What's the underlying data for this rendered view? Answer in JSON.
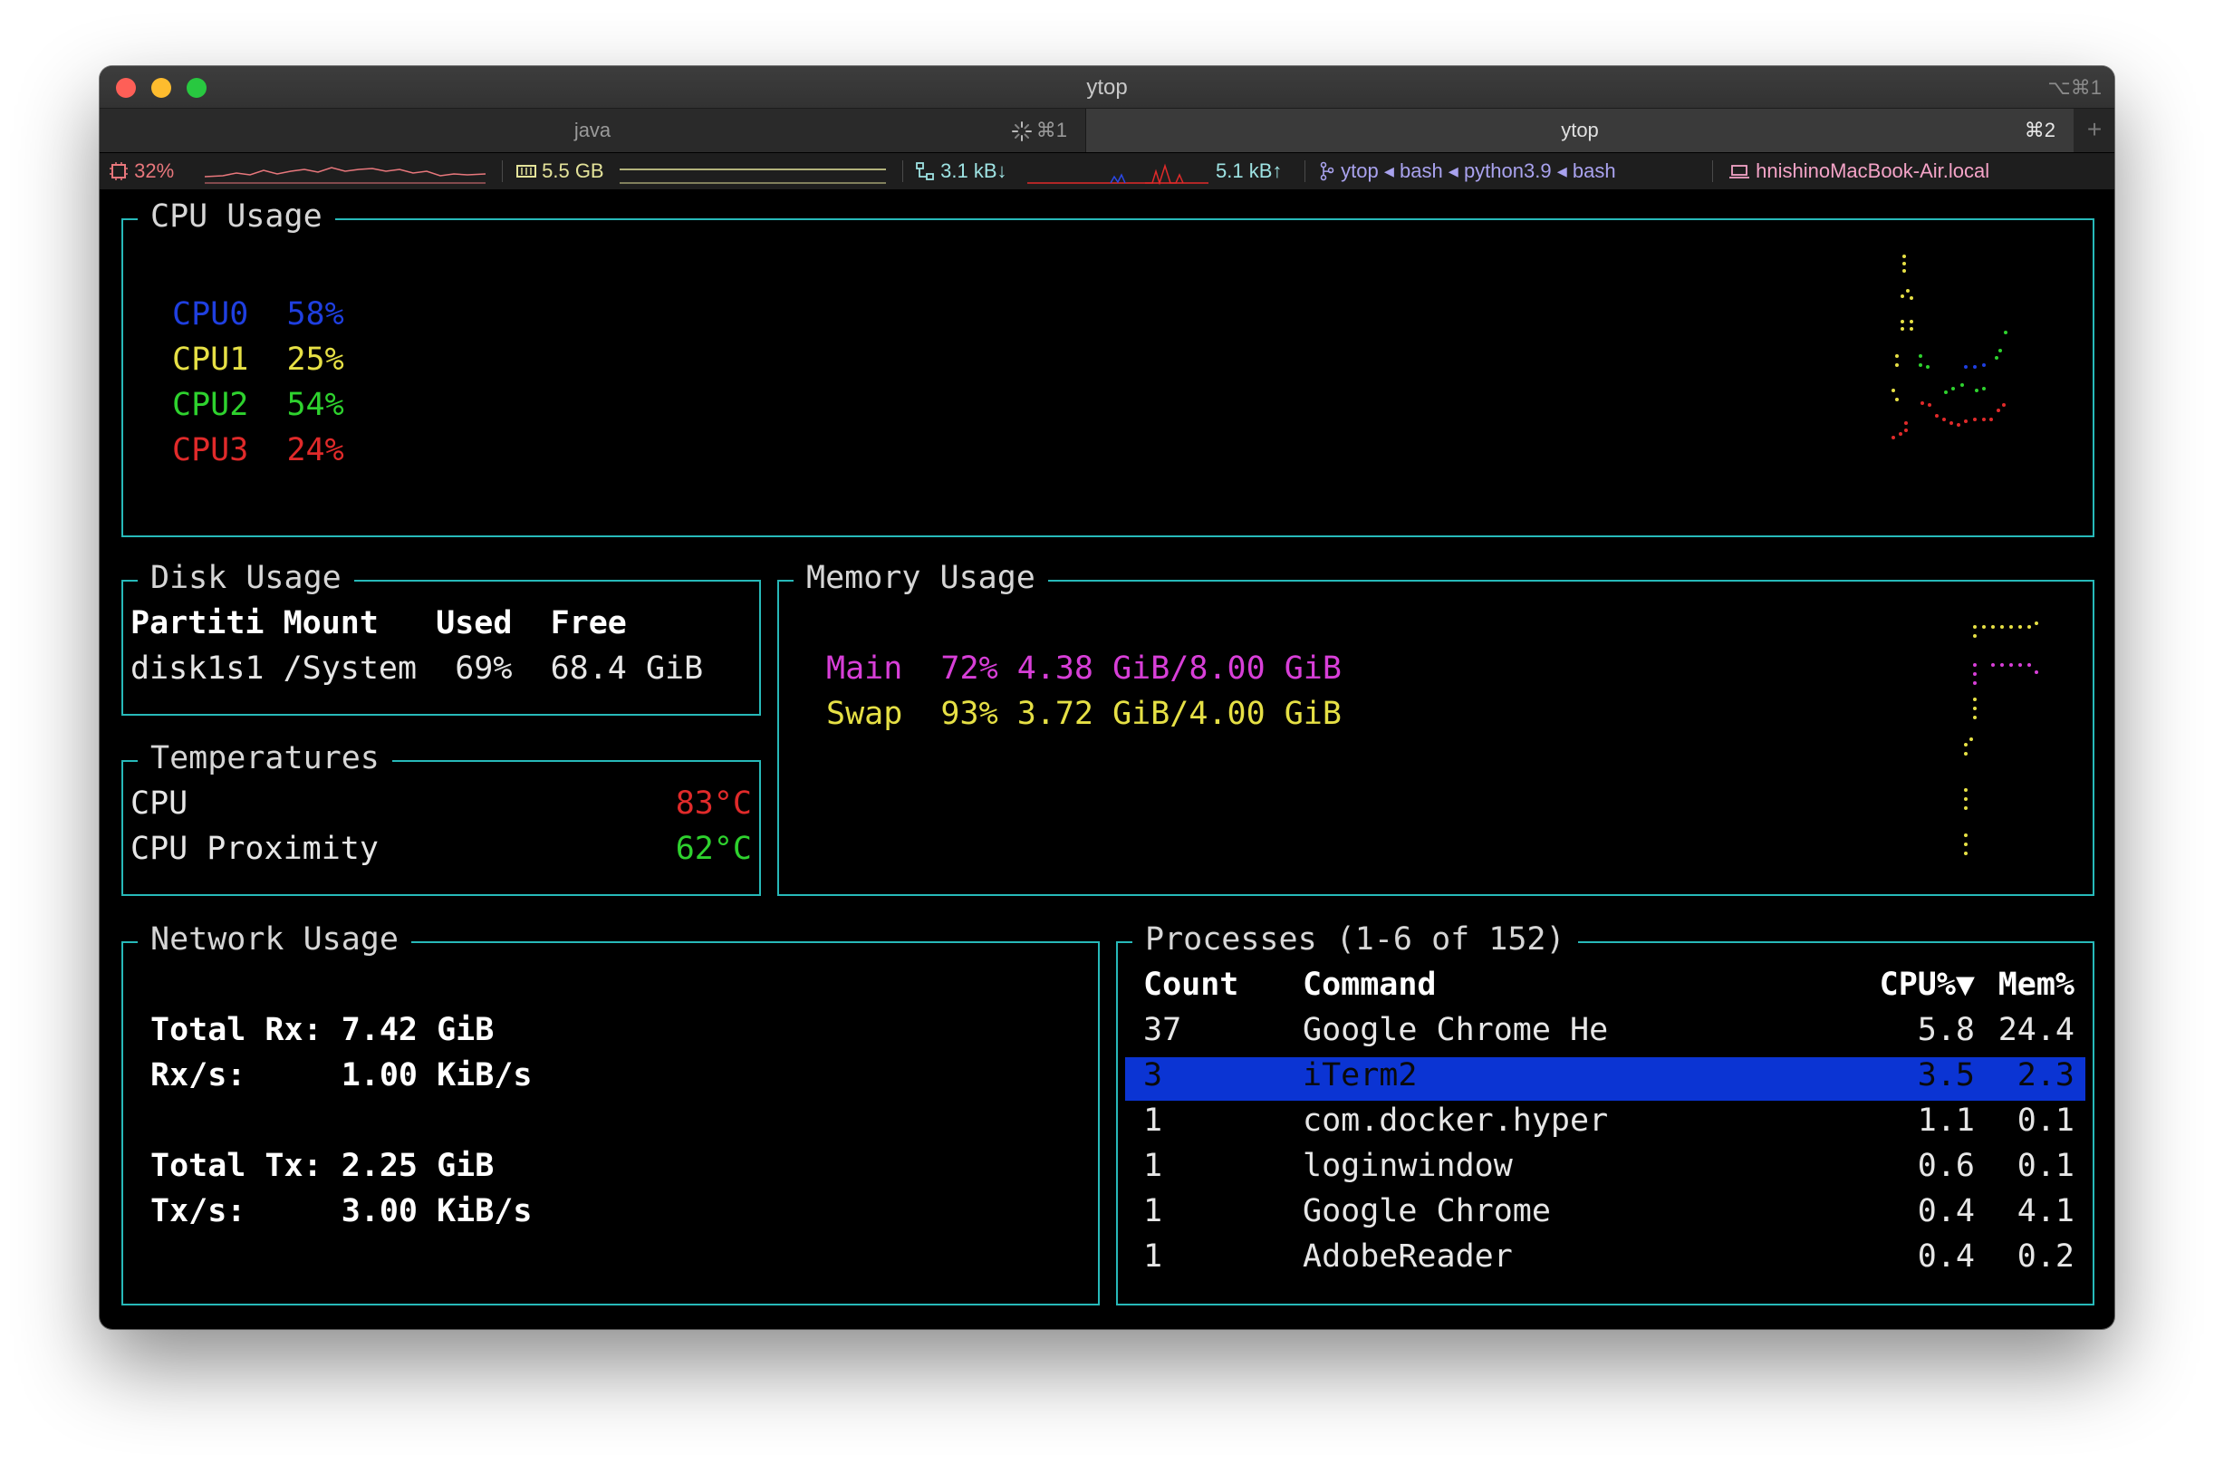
{
  "window": {
    "title": "ytop",
    "shortcut": "⌥⌘1"
  },
  "tabs": [
    {
      "label": "java",
      "shortcut": "⌘1"
    },
    {
      "label": "ytop",
      "shortcut": "⌘2"
    }
  ],
  "tab_add": "+",
  "status": {
    "cpu": "32%",
    "memory": "5.5 GB",
    "net_down": "3.1 kB↓",
    "net_up": "5.1 kB↑",
    "jobs": "ytop ◂ bash ◂ python3.9 ◂ bash",
    "host": "hnishinoMacBook-Air.local"
  },
  "cpu_pane": {
    "title": "CPU Usage",
    "cores": [
      {
        "name": "CPU0",
        "value": "58%",
        "color": "#1f3fe0"
      },
      {
        "name": "CPU1",
        "value": "25%",
        "color": "#e6e045"
      },
      {
        "name": "CPU2",
        "value": "54%",
        "color": "#2ed22e"
      },
      {
        "name": "CPU3",
        "value": "24%",
        "color": "#e02a2a"
      }
    ]
  },
  "disk_pane": {
    "title": "Disk Usage",
    "header": "Partiti Mount   Used  Free",
    "rows": [
      "disk1s1 /System  69%  68.4 GiB"
    ]
  },
  "temp_pane": {
    "title": "Temperatures",
    "rows": [
      {
        "label": "CPU",
        "value": "83°C",
        "color": "#e02a2a"
      },
      {
        "label": "CPU Proximity",
        "value": "62°C",
        "color": "#2ed22e"
      }
    ]
  },
  "mem_pane": {
    "title": "Memory Usage",
    "rows": [
      {
        "text": "Main  72% 4.38 GiB/8.00 GiB",
        "color": "#d83fd8"
      },
      {
        "text": "Swap  93% 3.72 GiB/4.00 GiB",
        "color": "#e6e045"
      }
    ]
  },
  "net_pane": {
    "title": "Network Usage",
    "rows": [
      "Total Rx: 7.42 GiB",
      "Rx/s:     1.00 KiB/s",
      "",
      "Total Tx: 2.25 GiB",
      "Tx/s:     3.00 KiB/s"
    ]
  },
  "proc_pane": {
    "title": "Processes (1-6 of 152)",
    "headers": {
      "count": "Count",
      "command": "Command",
      "cpu": "CPU%▼",
      "mem": "Mem%"
    },
    "rows": [
      {
        "count": "37",
        "command": "Google Chrome He",
        "cpu": "5.8",
        "mem": "24.4"
      },
      {
        "count": "3",
        "command": "iTerm2",
        "cpu": "3.5",
        "mem": "2.3"
      },
      {
        "count": "1",
        "command": "com.docker.hyper",
        "cpu": "1.1",
        "mem": "0.1"
      },
      {
        "count": "1",
        "command": "loginwindow",
        "cpu": "0.6",
        "mem": "0.1"
      },
      {
        "count": "1",
        "command": "Google Chrome",
        "cpu": "0.4",
        "mem": "4.1"
      },
      {
        "count": "1",
        "command": "AdobeReader",
        "cpu": "0.4",
        "mem": "0.2"
      }
    ],
    "selected_index": 1
  },
  "colors": {
    "border": "#27b9b9",
    "selection": "#0b34d3"
  }
}
